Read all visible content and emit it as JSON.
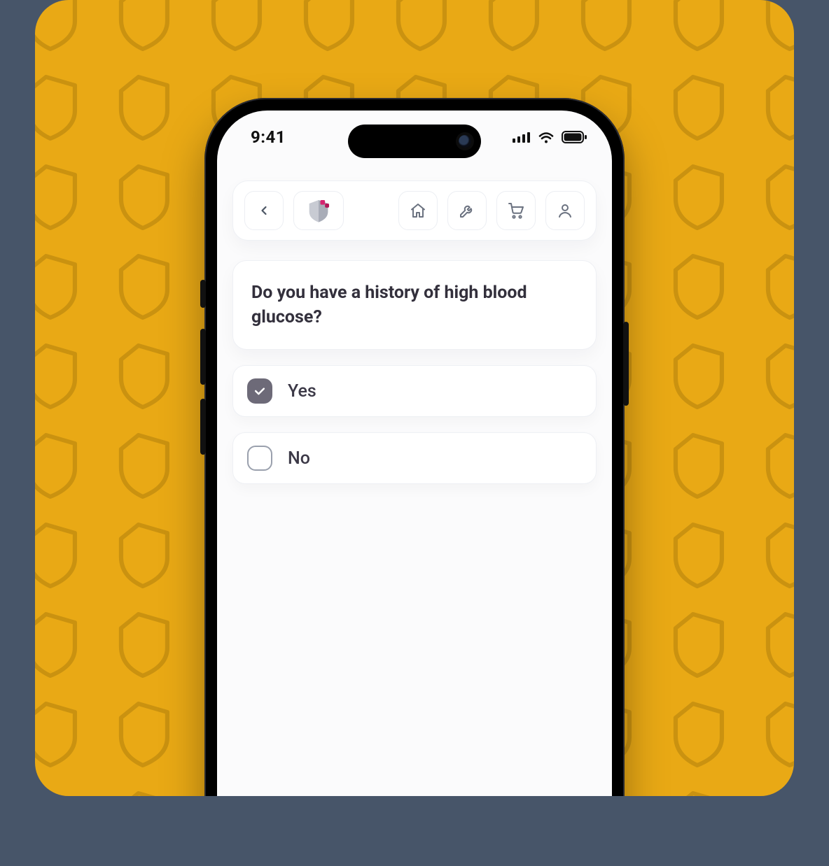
{
  "statusbar": {
    "time": "9:41"
  },
  "question": {
    "text": "Do you have a history of high blood glucose?"
  },
  "options": [
    {
      "label": "Yes",
      "checked": true
    },
    {
      "label": "No",
      "checked": false
    }
  ],
  "nav": {
    "back_icon": "chevron-left",
    "logo_icon": "shield",
    "home_icon": "home",
    "tools_icon": "tools",
    "cart_icon": "cart",
    "profile_icon": "user"
  },
  "colors": {
    "accent_pink": "#d6246f",
    "stage_bg": "#e9a915"
  }
}
